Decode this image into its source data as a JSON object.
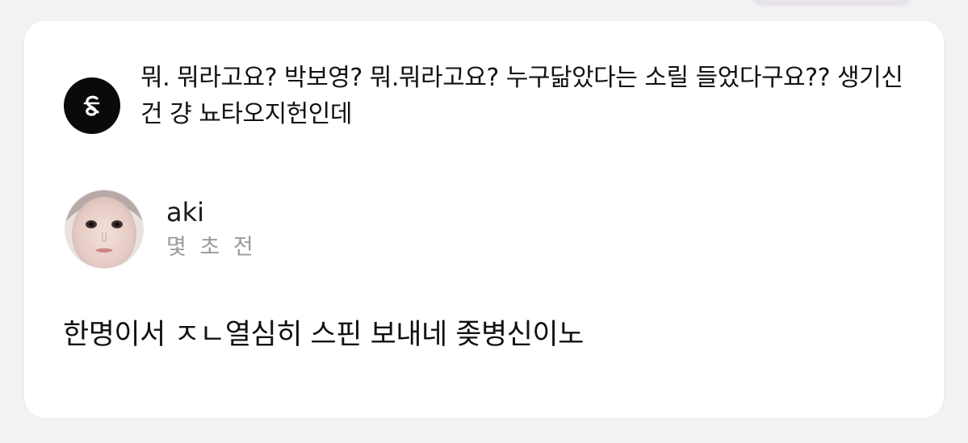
{
  "quote": {
    "icon": "ampersand-logo-icon",
    "text": "뭐. 뭐라고요? 박보영? 뭐.뭐라고요? 누구닮았다는 소릴 들었다구요?? 생기신건 걍 뇨타오지헌인데"
  },
  "comment": {
    "author": "aki",
    "time": "몇 초 전",
    "avatar": "user-avatar",
    "body": "한명이서 ㅈㄴ열심히 스핀 보내네 좆병신이노"
  },
  "colors": {
    "background": "#f2f2f4",
    "card": "#ffffff",
    "badge": "#0a0a0a",
    "meta_text": "#9a9a9a"
  }
}
